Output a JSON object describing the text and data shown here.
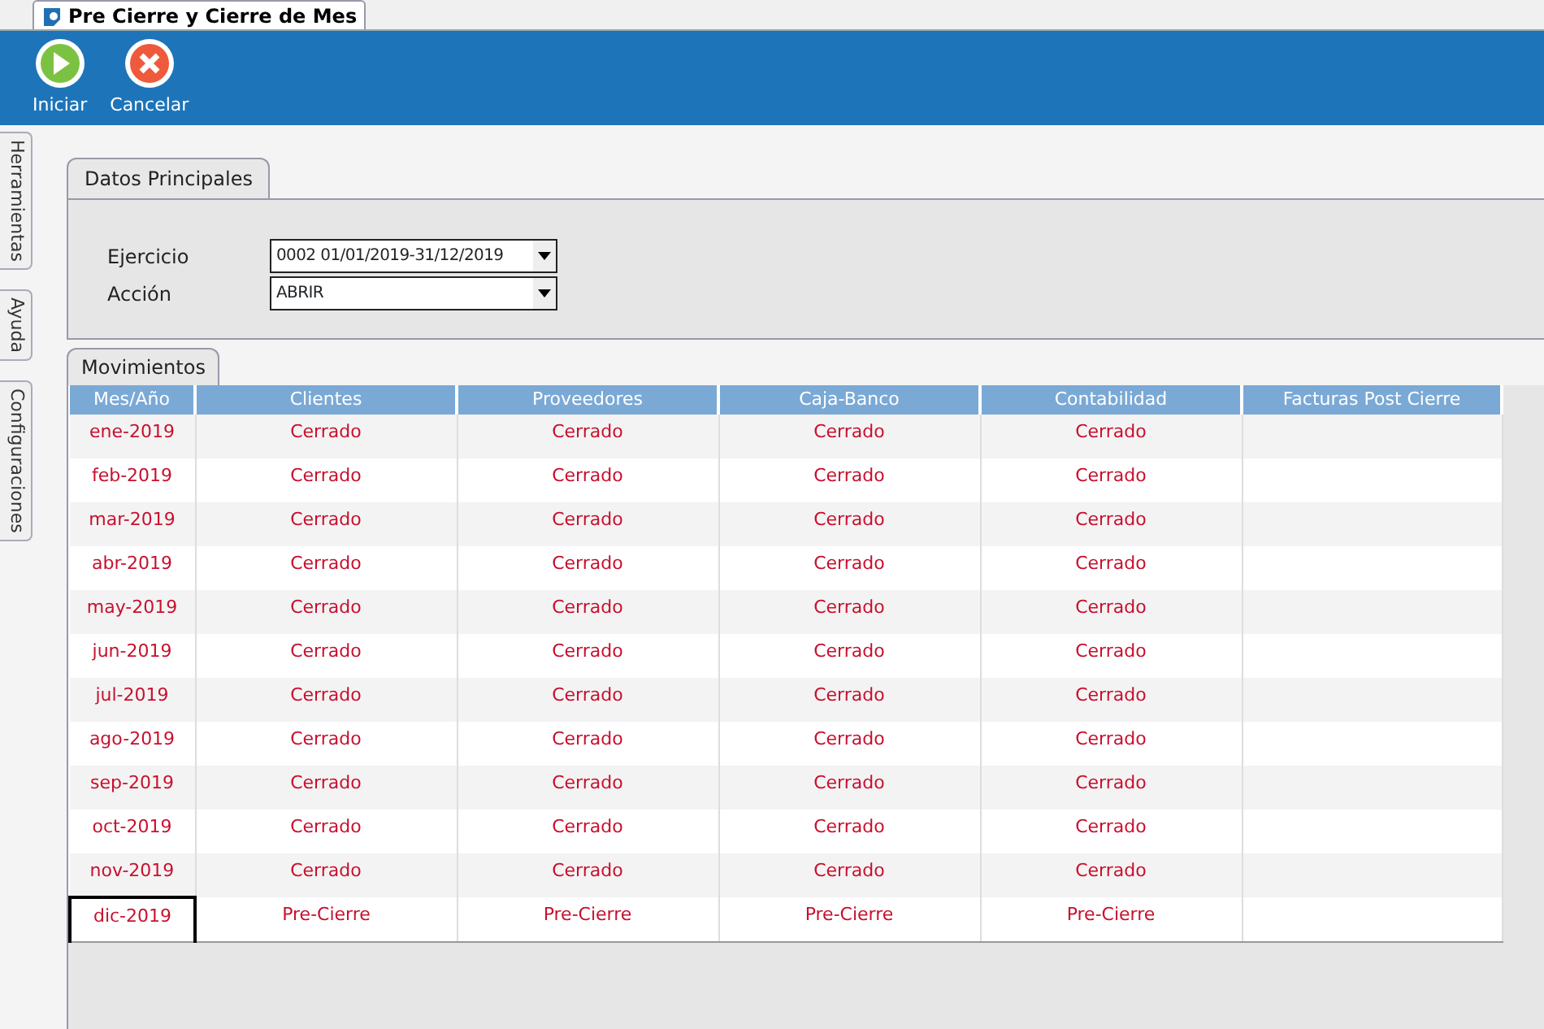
{
  "window": {
    "title": "Pre Cierre y Cierre de Mes"
  },
  "toolbar": [
    {
      "kind": "start",
      "label": "Iniciar"
    },
    {
      "kind": "cancel",
      "label": "Cancelar"
    }
  ],
  "side_tabs": [
    "Herramientas",
    "Ayuda",
    "Configuraciones"
  ],
  "main_section": {
    "title": "Datos Principales",
    "fields": [
      {
        "label": "Ejercicio",
        "value": "0002 01/01/2019-31/12/2019"
      },
      {
        "label": "Acción",
        "value": "ABRIR"
      }
    ]
  },
  "movements": {
    "title": "Movimientos",
    "columns": [
      "Mes/Año",
      "Clientes",
      "Proveedores",
      "Caja-Banco",
      "Contabilidad",
      "Facturas Post Cierre"
    ],
    "rows": [
      {
        "cells": [
          "ene-2019",
          "Cerrado",
          "Cerrado",
          "Cerrado",
          "Cerrado",
          ""
        ],
        "current": false
      },
      {
        "cells": [
          "feb-2019",
          "Cerrado",
          "Cerrado",
          "Cerrado",
          "Cerrado",
          ""
        ],
        "current": false
      },
      {
        "cells": [
          "mar-2019",
          "Cerrado",
          "Cerrado",
          "Cerrado",
          "Cerrado",
          ""
        ],
        "current": false
      },
      {
        "cells": [
          "abr-2019",
          "Cerrado",
          "Cerrado",
          "Cerrado",
          "Cerrado",
          ""
        ],
        "current": false
      },
      {
        "cells": [
          "may-2019",
          "Cerrado",
          "Cerrado",
          "Cerrado",
          "Cerrado",
          ""
        ],
        "current": false
      },
      {
        "cells": [
          "jun-2019",
          "Cerrado",
          "Cerrado",
          "Cerrado",
          "Cerrado",
          ""
        ],
        "current": false
      },
      {
        "cells": [
          "jul-2019",
          "Cerrado",
          "Cerrado",
          "Cerrado",
          "Cerrado",
          ""
        ],
        "current": false
      },
      {
        "cells": [
          "ago-2019",
          "Cerrado",
          "Cerrado",
          "Cerrado",
          "Cerrado",
          ""
        ],
        "current": false
      },
      {
        "cells": [
          "sep-2019",
          "Cerrado",
          "Cerrado",
          "Cerrado",
          "Cerrado",
          ""
        ],
        "current": false
      },
      {
        "cells": [
          "oct-2019",
          "Cerrado",
          "Cerrado",
          "Cerrado",
          "Cerrado",
          ""
        ],
        "current": false
      },
      {
        "cells": [
          "nov-2019",
          "Cerrado",
          "Cerrado",
          "Cerrado",
          "Cerrado",
          ""
        ],
        "current": false
      },
      {
        "cells": [
          "dic-2019",
          "Pre-Cierre",
          "Pre-Cierre",
          "Pre-Cierre",
          "Pre-Cierre",
          ""
        ],
        "current": true
      }
    ]
  }
}
